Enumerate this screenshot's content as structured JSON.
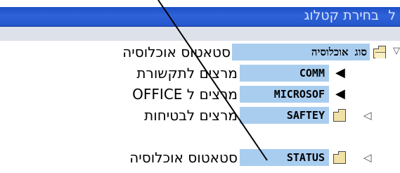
{
  "window": {
    "title": "בחירת קטלוג",
    "title_glyph": "ל"
  },
  "tree": {
    "root": {
      "key": "סוג אוכלוסיה",
      "description": "סטאטוס אוכלוסיה"
    },
    "items": [
      {
        "key": "COMM",
        "description": "מרצים לתקשורת"
      },
      {
        "key": "MICROSOF",
        "description": "מרצים ל OFFICE"
      },
      {
        "key": "SAFTEY",
        "description": "מרצים לבטיחות"
      },
      {
        "key": "STATUS",
        "description": "סטאטוס אוכלוסיה"
      }
    ]
  },
  "icons": {
    "expand": "expand-triangle-icon",
    "open_folder": "open-folder-icon",
    "folder": "folder-icon",
    "leaf_arrow": "black-triangle-arrow-icon",
    "hollow_arrow": "hollow-triangle-arrow-icon"
  },
  "colors": {
    "key_highlight": "#a9cdef",
    "titlebar": "#2456cc"
  }
}
